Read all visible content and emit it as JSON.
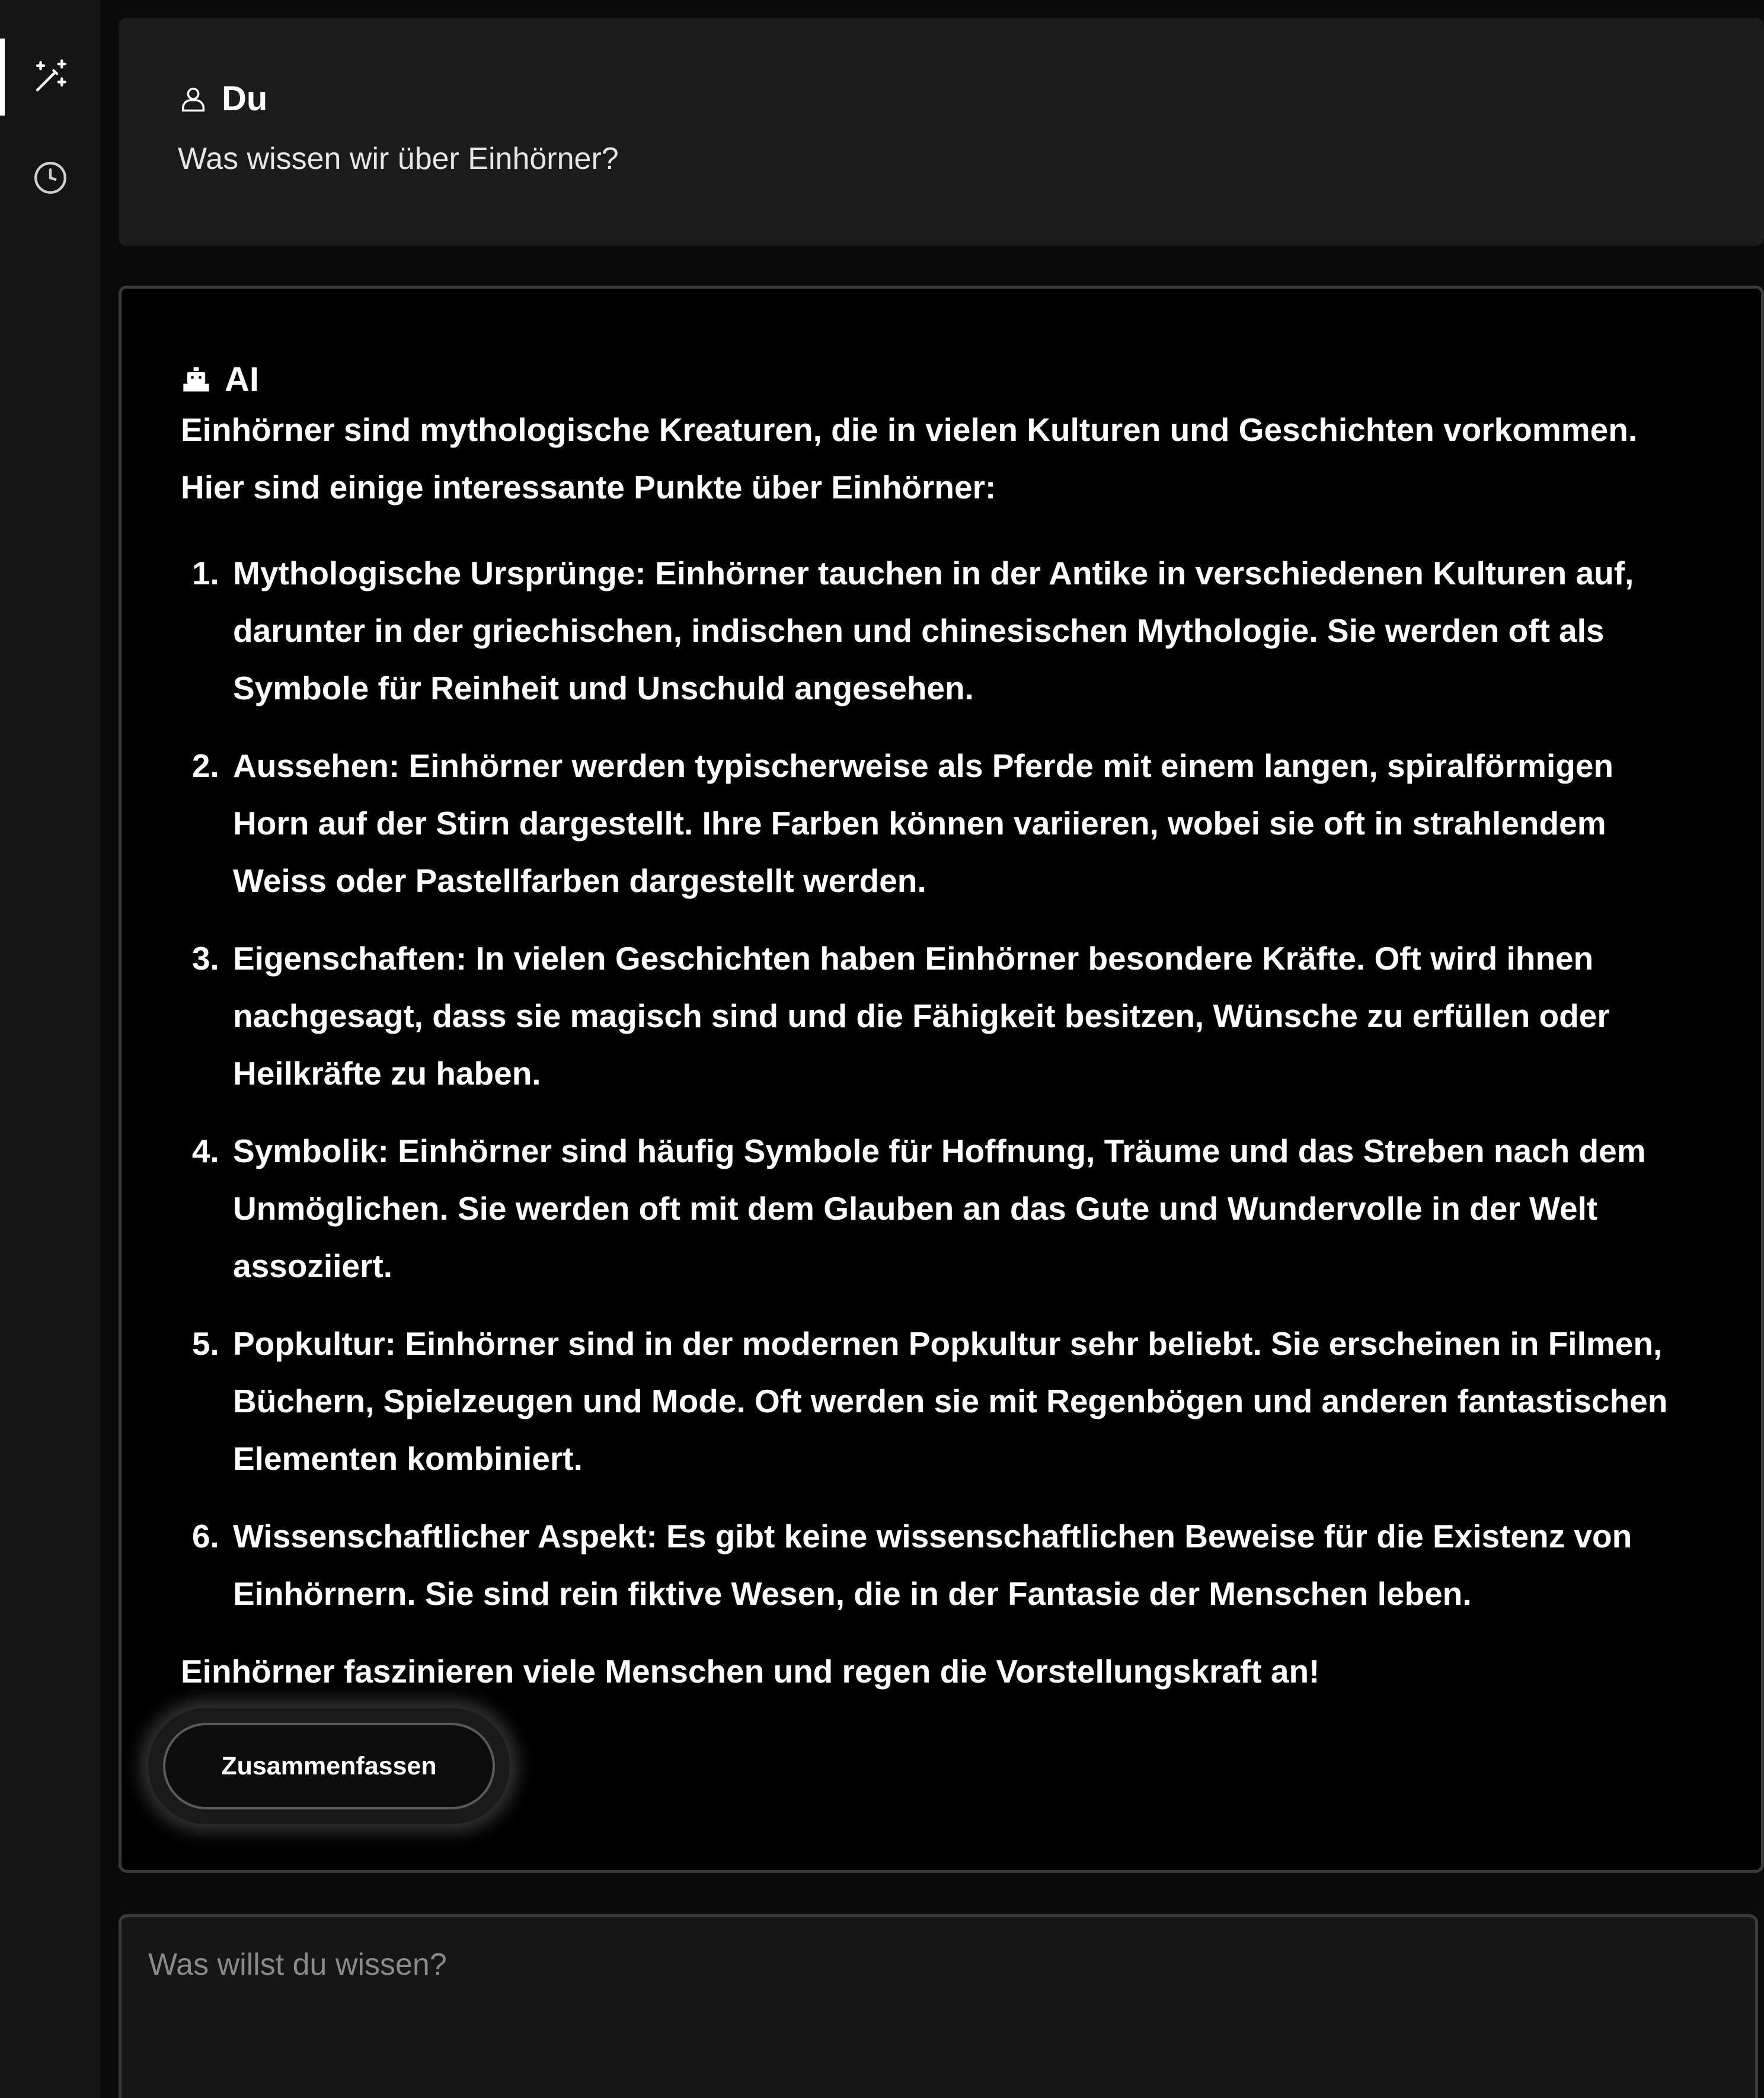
{
  "sidebar": {
    "items": [
      {
        "icon": "magic-wand-icon",
        "active": true
      },
      {
        "icon": "history-clock-icon",
        "active": false
      }
    ]
  },
  "user_message": {
    "author": "Du",
    "icon": "user-icon",
    "text": "Was wissen wir über Einhörner?"
  },
  "ai_message": {
    "author": "AI",
    "icon": "robot-icon",
    "intro": "Einhörner sind mythologische Kreaturen, die in vielen Kulturen und Geschichten vorkommen. Hier sind einige interessante Punkte über Einhörner:",
    "points": [
      "Mythologische Ursprünge: Einhörner tauchen in der Antike in verschiedenen Kulturen auf, darunter in der griechischen, indischen und chinesischen Mythologie. Sie werden oft als Symbole für Reinheit und Unschuld angesehen.",
      "Aussehen: Einhörner werden typischerweise als Pferde mit einem langen, spiralförmigen Horn auf der Stirn dargestellt. Ihre Farben können variieren, wobei sie oft in strahlendem Weiss oder Pastellfarben dargestellt werden.",
      "Eigenschaften: In vielen Geschichten haben Einhörner besondere Kräfte. Oft wird ihnen nachgesagt, dass sie magisch sind und die Fähigkeit besitzen, Wünsche zu erfüllen oder Heilkräfte zu haben.",
      "Symbolik: Einhörner sind häufig Symbole für Hoffnung, Träume und das Streben nach dem Unmöglichen. Sie werden oft mit dem Glauben an das Gute und Wundervolle in der Welt assoziiert.",
      "Popkultur: Einhörner sind in der modernen Popkultur sehr beliebt. Sie erscheinen in Filmen, Büchern, Spielzeugen und Mode. Oft werden sie mit Regenbögen und anderen fantastischen Elementen kombiniert.",
      "Wissenschaftlicher Aspekt: Es gibt keine wissenschaftlichen Beweise für die Existenz von Einhörnern. Sie sind rein fiktive Wesen, die in der Fantasie der Menschen leben."
    ],
    "outro": "Einhörner faszinieren viele Menschen und regen die Vorstellungskraft an!",
    "summarize_label": "Zusammenfassen"
  },
  "input": {
    "placeholder": "Was willst du wissen?",
    "value": ""
  },
  "colors": {
    "background": "#0a0a0a",
    "sidebar": "#141414",
    "user_card": "#1b1b1b",
    "ai_card": "#000000",
    "border": "#3a3a3a",
    "text": "#ffffff"
  }
}
